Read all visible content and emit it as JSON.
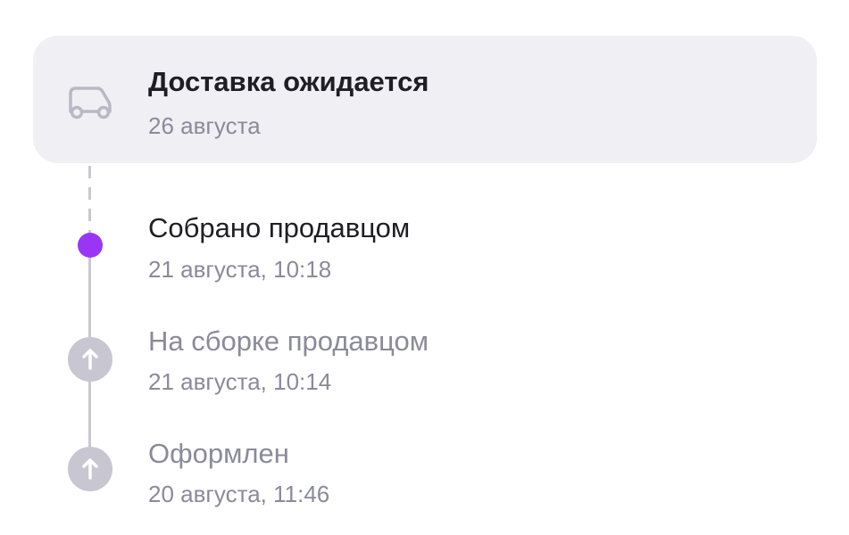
{
  "delivery": {
    "icon": "truck-icon",
    "title": "Доставка ожидается",
    "date": "26 августа"
  },
  "timeline": [
    {
      "title": "Собрано продавцом",
      "date": "21 августа, 10:18",
      "status": "current",
      "icon": "dot"
    },
    {
      "title": "На сборке продавцом",
      "date": "21 августа, 10:14",
      "status": "past",
      "icon": "arrow-up-icon"
    },
    {
      "title": "Оформлен",
      "date": "20 августа, 11:46",
      "status": "past",
      "icon": "arrow-up-icon"
    }
  ],
  "colors": {
    "accent": "#9a35f5",
    "card_bg": "#f0eff4",
    "primary_text": "#1e1e24",
    "secondary_text": "#8b8a99",
    "line": "#c9c8d1"
  }
}
